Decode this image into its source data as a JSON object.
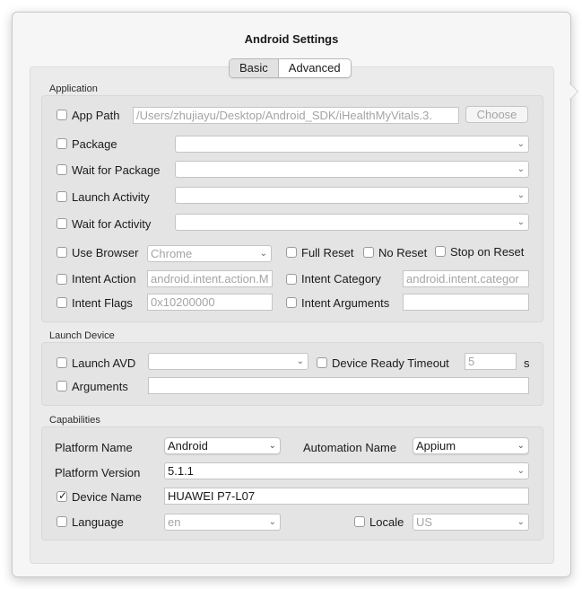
{
  "dialog": {
    "title": "Android Settings"
  },
  "tabs": [
    {
      "label": "Basic",
      "selected": true
    },
    {
      "label": "Advanced",
      "selected": false
    }
  ],
  "application": {
    "section_label": "Application",
    "app_path": {
      "label": "App Path",
      "checked": false,
      "value": "/Users/zhujiayu/Desktop/Android_SDK/iHealthMyVitals.3.",
      "choose_label": "Choose"
    },
    "package": {
      "label": "Package",
      "checked": false,
      "value": ""
    },
    "wait_for_package": {
      "label": "Wait for Package",
      "checked": false,
      "value": ""
    },
    "launch_activity": {
      "label": "Launch Activity",
      "checked": false,
      "value": ""
    },
    "wait_for_activity": {
      "label": "Wait for Activity",
      "checked": false,
      "value": ""
    },
    "use_browser": {
      "label": "Use Browser",
      "checked": false,
      "value": "Chrome"
    },
    "full_reset": {
      "label": "Full Reset",
      "checked": false
    },
    "no_reset": {
      "label": "No Reset",
      "checked": false
    },
    "stop_on_reset": {
      "label": "Stop on Reset",
      "checked": false
    },
    "intent_action": {
      "label": "Intent Action",
      "checked": false,
      "placeholder": "android.intent.action.M"
    },
    "intent_category": {
      "label": "Intent Category",
      "checked": false,
      "placeholder": "android.intent.categor"
    },
    "intent_flags": {
      "label": "Intent Flags",
      "checked": false,
      "placeholder": "0x10200000"
    },
    "intent_arguments": {
      "label": "Intent Arguments",
      "checked": false,
      "value": ""
    }
  },
  "launch_device": {
    "section_label": "Launch Device",
    "launch_avd": {
      "label": "Launch AVD",
      "checked": false,
      "value": ""
    },
    "device_ready_timeout": {
      "label": "Device Ready Timeout",
      "checked": false,
      "value": "5",
      "unit": "s"
    },
    "arguments": {
      "label": "Arguments",
      "checked": false,
      "value": ""
    }
  },
  "capabilities": {
    "section_label": "Capabilities",
    "platform_name": {
      "label": "Platform Name",
      "value": "Android"
    },
    "automation_name": {
      "label": "Automation Name",
      "value": "Appium"
    },
    "platform_version": {
      "label": "Platform Version",
      "value": "5.1.1"
    },
    "device_name": {
      "label": "Device Name",
      "checked": true,
      "value": "HUAWEI P7-L07"
    },
    "language": {
      "label": "Language",
      "checked": false,
      "value": "en"
    },
    "locale": {
      "label": "Locale",
      "checked": false,
      "value": "US"
    }
  },
  "icons": {
    "chevron": "chevron-down-icon",
    "checkmark": "checkmark-icon"
  }
}
